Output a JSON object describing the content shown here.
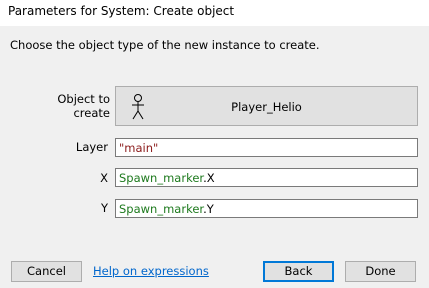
{
  "window": {
    "title": "Parameters for System: Create object"
  },
  "instruction": "Choose the object type of the new instance to create.",
  "fields": {
    "object": {
      "label": "Object to create",
      "value": "Player_Helio",
      "icon": "stick-figure-icon"
    },
    "layer": {
      "label": "Layer",
      "value": "\"main\""
    },
    "x": {
      "label": "X",
      "object": "Spawn_marker",
      "expression": ".X"
    },
    "y": {
      "label": "Y",
      "object": "Spawn_marker",
      "expression": ".Y"
    }
  },
  "footer": {
    "cancel_label": "Cancel",
    "help_label": "Help on expressions",
    "back_label": "Back",
    "done_label": "Done"
  },
  "colors": {
    "string_literal": "#8b1a1a",
    "object_reference": "#1e7a1e",
    "link": "#0066cc",
    "focus_border": "#0078d7"
  }
}
